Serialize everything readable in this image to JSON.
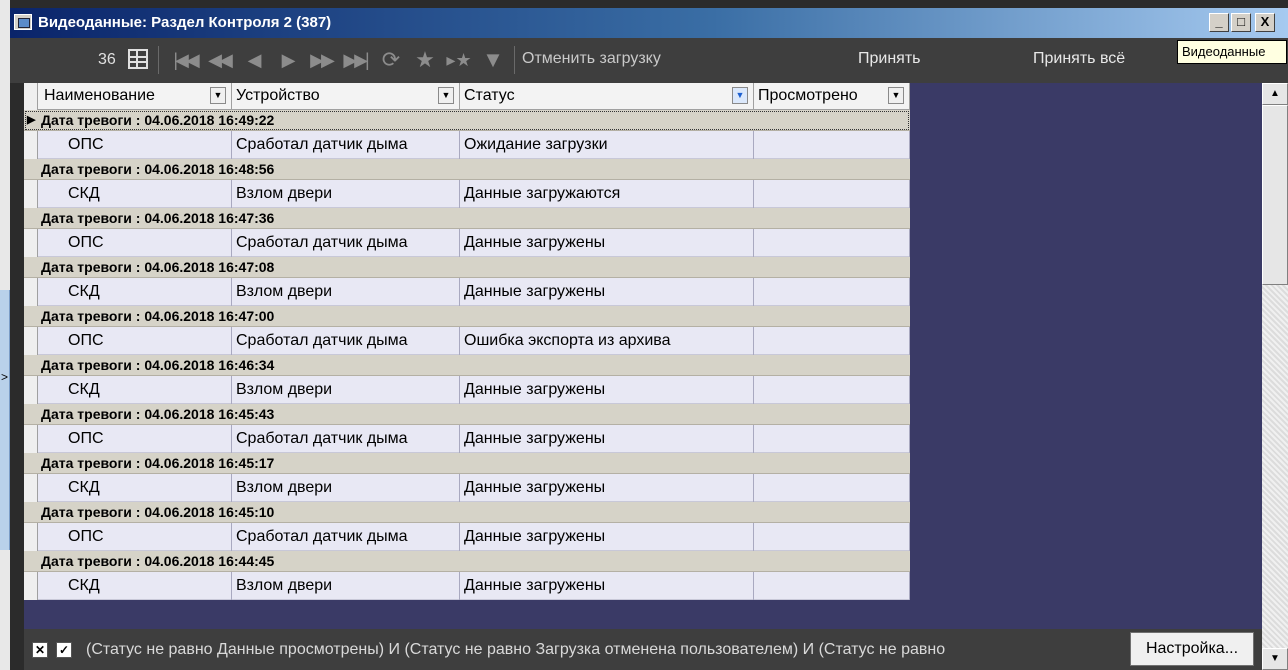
{
  "window": {
    "title": "Видеоданные: Раздел  Контроля 2 (387)",
    "min_glyph": "_",
    "max_glyph": "□",
    "close_glyph": "X"
  },
  "toolbar": {
    "count": "36",
    "cancel_download": "Отменить загрузку",
    "accept": "Принять",
    "accept_all": "Принять всё",
    "tooltip": "Видеоданные"
  },
  "columns": {
    "name": "Наименование",
    "device": "Устройство",
    "status": "Статус",
    "viewed": "Просмотрено"
  },
  "groups": [
    {
      "label": "Дата тревоги : 04.06.2018 16:49:22",
      "name": "ОПС",
      "device": "Сработал датчик дыма",
      "status": "Ожидание загрузки",
      "viewed": ""
    },
    {
      "label": "Дата тревоги : 04.06.2018 16:48:56",
      "name": "СКД",
      "device": "Взлом двери",
      "status": "Данные загружаются",
      "viewed": ""
    },
    {
      "label": "Дата тревоги : 04.06.2018 16:47:36",
      "name": "ОПС",
      "device": "Сработал датчик дыма",
      "status": "Данные загружены",
      "viewed": ""
    },
    {
      "label": "Дата тревоги : 04.06.2018 16:47:08",
      "name": "СКД",
      "device": "Взлом двери",
      "status": "Данные загружены",
      "viewed": ""
    },
    {
      "label": "Дата тревоги : 04.06.2018 16:47:00",
      "name": "ОПС",
      "device": "Сработал датчик дыма",
      "status": "Ошибка экспорта из архива",
      "viewed": ""
    },
    {
      "label": "Дата тревоги : 04.06.2018 16:46:34",
      "name": "СКД",
      "device": "Взлом двери",
      "status": "Данные загружены",
      "viewed": ""
    },
    {
      "label": "Дата тревоги : 04.06.2018 16:45:43",
      "name": "ОПС",
      "device": "Сработал датчик дыма",
      "status": "Данные загружены",
      "viewed": ""
    },
    {
      "label": "Дата тревоги : 04.06.2018 16:45:17",
      "name": "СКД",
      "device": "Взлом двери",
      "status": "Данные загружены",
      "viewed": ""
    },
    {
      "label": "Дата тревоги : 04.06.2018 16:45:10",
      "name": "ОПС",
      "device": "Сработал датчик дыма",
      "status": "Данные загружены",
      "viewed": ""
    },
    {
      "label": "Дата тревоги : 04.06.2018 16:44:45",
      "name": "СКД",
      "device": "Взлом двери",
      "status": "Данные загружены",
      "viewed": ""
    }
  ],
  "filter": {
    "text": "(Статус не равно Данные просмотрены) И (Статус не равно Загрузка отменена пользователем) И (Статус не равно",
    "settings_button": "Настройка..."
  },
  "colors": {
    "panel_background": "#3a3a66",
    "row_background": "#e8e8f4",
    "group_background": "#d6d3c8"
  }
}
